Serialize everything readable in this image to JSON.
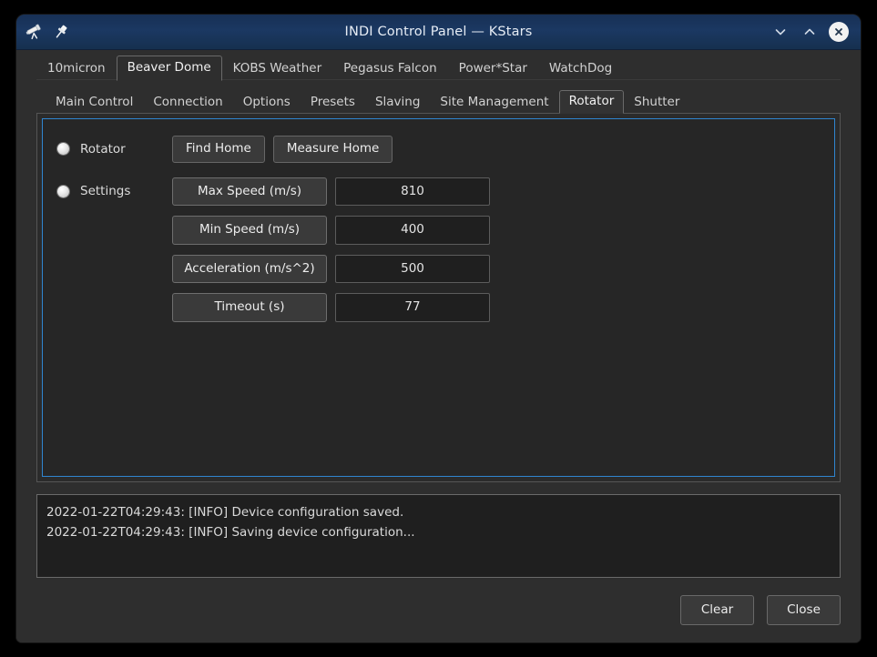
{
  "window": {
    "title": "INDI Control Panel — KStars",
    "icons": [
      {
        "name": "telescope-icon"
      },
      {
        "name": "pin-icon"
      }
    ],
    "controls": [
      {
        "name": "minimize-button",
        "icon": "chevron-down-icon"
      },
      {
        "name": "maximize-button",
        "icon": "chevron-up-icon"
      },
      {
        "name": "close-button",
        "icon": "close-icon"
      }
    ]
  },
  "device_tabs": [
    {
      "label": "10micron",
      "active": false
    },
    {
      "label": "Beaver Dome",
      "active": true
    },
    {
      "label": "KOBS Weather",
      "active": false
    },
    {
      "label": "Pegasus Falcon",
      "active": false
    },
    {
      "label": "Power*Star",
      "active": false
    },
    {
      "label": "WatchDog",
      "active": false
    }
  ],
  "property_tabs": [
    {
      "label": "Main Control",
      "active": false
    },
    {
      "label": "Connection",
      "active": false
    },
    {
      "label": "Options",
      "active": false
    },
    {
      "label": "Presets",
      "active": false
    },
    {
      "label": "Slaving",
      "active": false
    },
    {
      "label": "Site Management",
      "active": false
    },
    {
      "label": "Rotator",
      "active": true
    },
    {
      "label": "Shutter",
      "active": false
    }
  ],
  "rotator_panel": {
    "groups": [
      {
        "name": "rotator",
        "label": "Rotator",
        "led_state": "idle",
        "buttons": [
          {
            "label": "Find Home"
          },
          {
            "label": "Measure Home"
          }
        ]
      },
      {
        "name": "settings",
        "label": "Settings",
        "led_state": "idle",
        "fields": [
          {
            "label": "Max Speed (m/s)",
            "value": "810"
          },
          {
            "label": "Min Speed (m/s)",
            "value": "400"
          },
          {
            "label": "Acceleration (m/s^2)",
            "value": "500"
          },
          {
            "label": "Timeout (s)",
            "value": "77"
          }
        ]
      }
    ]
  },
  "log": {
    "lines": [
      "2022-01-22T04:29:43: [INFO] Device configuration saved.",
      "2022-01-22T04:29:43: [INFO] Saving device configuration..."
    ]
  },
  "footer": {
    "clear_label": "Clear",
    "close_label": "Close"
  },
  "colors": {
    "titlebar": "#1b3862",
    "window_bg": "#2e2e2e",
    "panel_bg": "#262626",
    "focus_border": "#2f85d0",
    "field_bg": "#1f1f1f",
    "text": "#dcdcdc"
  }
}
